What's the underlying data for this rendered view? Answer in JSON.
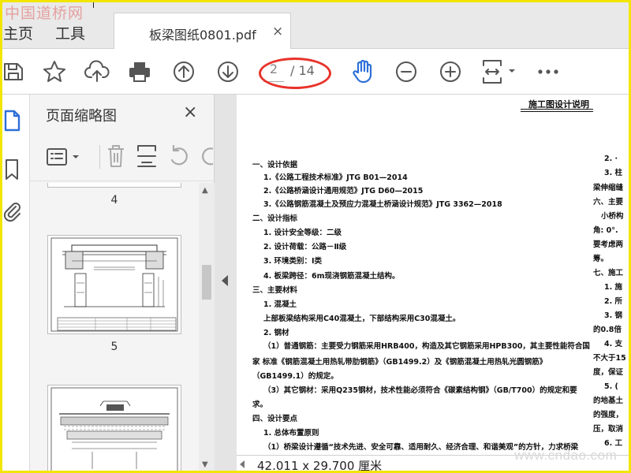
{
  "watermark_top": "中国道桥网",
  "watermark_bottom": "www.cndao.com",
  "menu": {
    "home": "主页",
    "tools": "工具"
  },
  "tab": {
    "title": "板梁图纸0801.pdf",
    "close": "×"
  },
  "toolbar": {
    "current_page": "2",
    "total_pages": "/ 14"
  },
  "thumbnails": {
    "title": "页面缩略图",
    "close": "×",
    "pages": [
      {
        "label": "4"
      },
      {
        "label": "5"
      }
    ]
  },
  "document": {
    "heading": "施工图设计说明",
    "lines": [
      "一、设计依据",
      "1.《公路工程技术标准》JTG B01—2014",
      "2.《公路桥涵设计通用规范》JTG D60—2015",
      "3.《公路钢筋混凝土及预应力混凝土桥涵设计规范》JTG 3362—2018",
      "二、设计指标",
      "1. 设计安全等级：二级",
      "2. 设计荷载：公路－Ⅱ级",
      "3. 环境类别：Ⅰ类",
      "4. 板梁跨径：6m现浇钢筋混凝土结构。",
      "三、主要材料",
      "1. 混凝土",
      "上部板梁结构采用C40混凝土，下部结构采用C30混凝土。",
      "2. 钢材",
      "（1）普通钢筋：主要受力钢筋采用HRB400，构造及其它钢筋采用HPB300，其主要性能符合国",
      "家 标准《钢筋混凝土用热轧带肋钢筋》（GB1499.2）及《钢筋混凝土用热轧光圆钢筋》",
      "（GB1499.1）的规定。",
      "（3）其它钢材：采用Q235钢材，技术性能必须符合《碳素结构钢》（GB/T700）的规定和要",
      "求。",
      "四、设计要点",
      "1. 总体布置原则",
      "（1）桥梁设计遵循“技术先进、安全可靠、适用耐久、经济合理、和谐美观”的方针，力求桥梁"
    ],
    "right_column": [
      "2. ·",
      "3. 柱",
      "梁伸缩缝",
      "六、主要",
      "小桥构",
      "角: 0°.",
      "要考虑两",
      "筹。",
      "七、施工",
      "1. 施",
      "2. 所",
      "3. 钢",
      "的0.8倍",
      "4. 支",
      "不大于15",
      "度，保证",
      "5. (",
      "的地基土",
      "的强度，",
      "压，取消",
      "6. 工"
    ]
  },
  "status": {
    "page_size": "42.011 x 29.700 厘米"
  },
  "colors": {
    "highlight_ellipse": "#e8322a",
    "frame": "#f2e600",
    "hand_tool": "#2d6fd8"
  }
}
